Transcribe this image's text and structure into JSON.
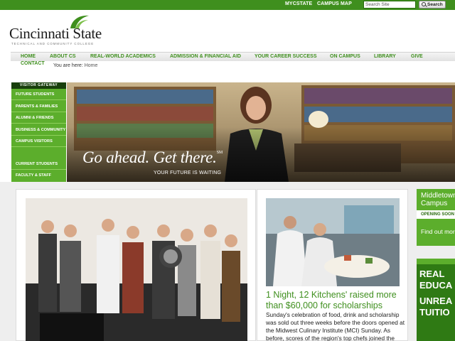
{
  "utility": {
    "links": [
      "MYCSTATE",
      "CAMPUS MAP"
    ],
    "search_placeholder": "Search Site",
    "search_button": "Search"
  },
  "logo": {
    "name": "Cincinnati State",
    "tagline": "TECHNICAL AND COMMUNITY COLLEGE"
  },
  "nav": {
    "items": [
      "HOME",
      "ABOUT CS",
      "REAL-WORLD ACADEMICS",
      "ADMISSION & FINANCIAL AID",
      "YOUR CAREER SUCCESS",
      "ON CAMPUS",
      "LIBRARY",
      "GIVE",
      "CONTACT"
    ]
  },
  "breadcrumb": {
    "prefix": "You are here:",
    "current": "Home"
  },
  "gateway": {
    "heading": "VISITOR GATEWAY",
    "items": [
      "FUTURE STUDENTS",
      "PARENTS & FAMILIES",
      "ALUMNI & FRIENDS",
      "BUSINESS & COMMUNITY",
      "CAMPUS VISITORS",
      "CURRENT STUDENTS",
      "FACULTY & STAFF"
    ]
  },
  "hero": {
    "headline": "Go ahead. Get there.",
    "mark": "SM",
    "subline": "YOUR FUTURE IS WAITING"
  },
  "news": {
    "title": "1 Night, 12 Kitchens' raised more than $60,000 for scholarships",
    "body": "Sunday's celebration of food, drink and scholarship was sold out three weeks before the doors opened at the Midwest Culinary Institute (MCI) Sunday. As before, scores of the region's top chefs joined the teaching"
  },
  "promos": {
    "middletown_title": "Middletown Campus",
    "middletown_sub": "OPENING SOON",
    "middletown_link": "Find out more",
    "real_lines": [
      "REAL",
      "EDUCA",
      "UNREA",
      "TUITIO"
    ]
  },
  "colors": {
    "brand_green": "#3f8f1e",
    "gateway_green": "#5cae2c",
    "dark_green": "#183f0c"
  }
}
